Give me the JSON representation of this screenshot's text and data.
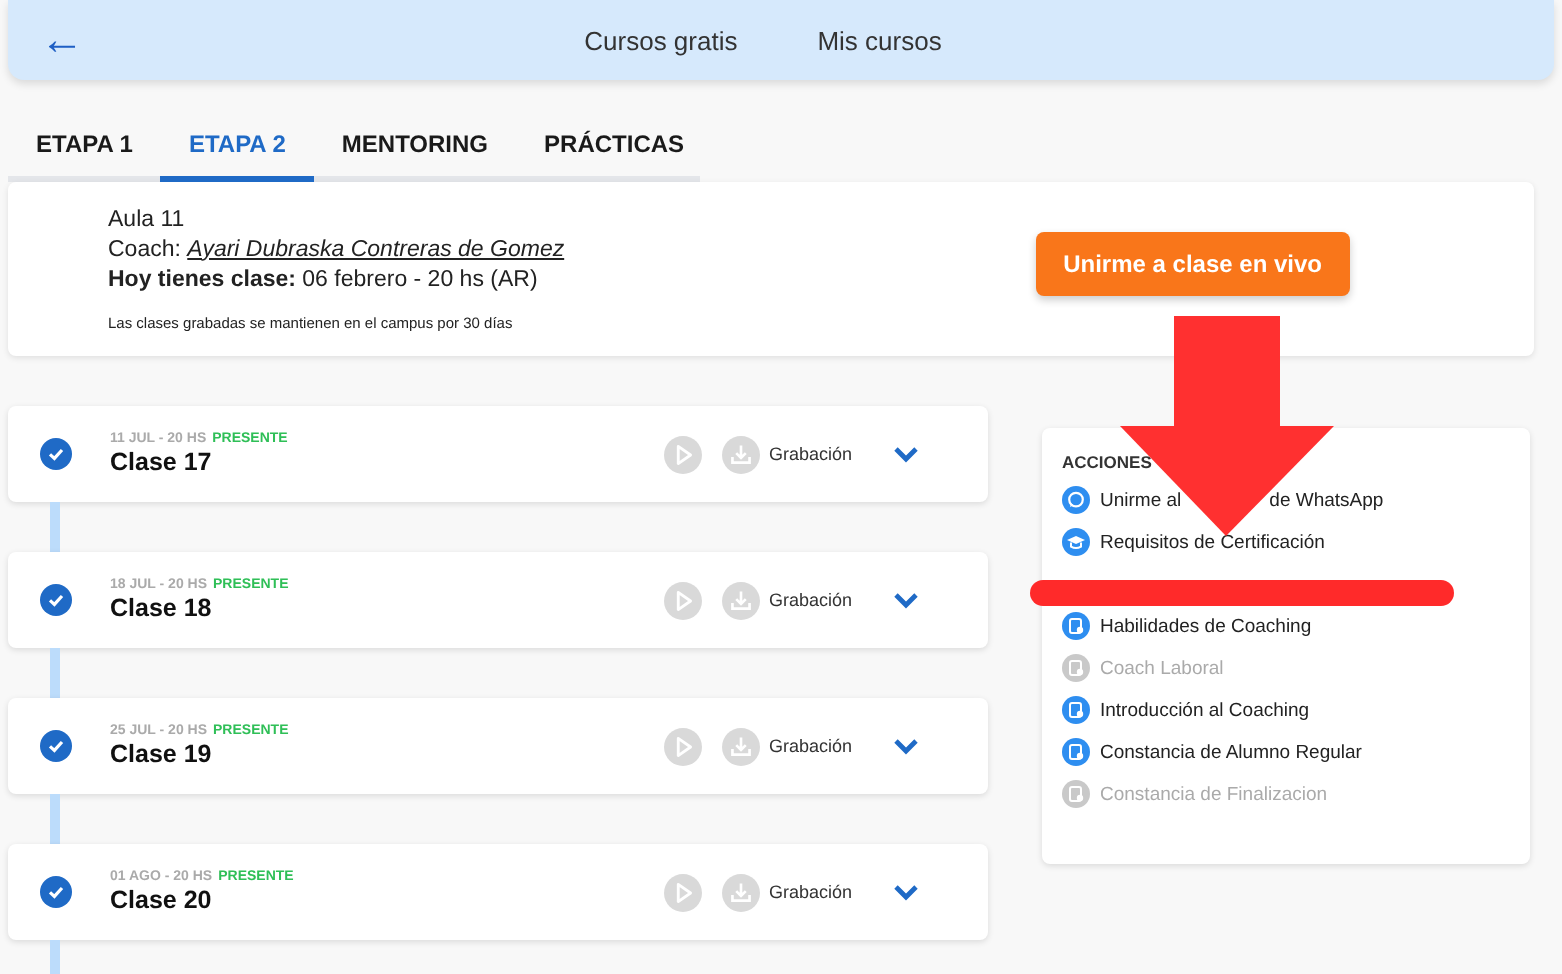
{
  "nav": {
    "back": "←",
    "links": [
      "Cursos gratis",
      "Mis cursos"
    ]
  },
  "tabs": [
    {
      "label": "ETAPA 1",
      "selected": false
    },
    {
      "label": "ETAPA 2",
      "selected": true
    },
    {
      "label": "MENTORING",
      "selected": false
    },
    {
      "label": "PRÁCTICAS",
      "selected": false
    }
  ],
  "class_info": {
    "room": "Aula 11",
    "coach_label": "Coach:",
    "coach": "Ayari Dubraska Contreras de Gomez",
    "today": "**Hoy tienes clase:** 06 febrero - 20 hs (AR)",
    "note": "Las clases grabadas se mantienen en el campus por 30 días",
    "button": "Unirme a clase en vivo"
  },
  "lessons": [
    {
      "date": "11 JUL - 20 HS",
      "status": "PRESENTE",
      "title": "Clase 17",
      "done": true,
      "recording": "Grabación"
    },
    {
      "date": "18 JUL - 20 HS",
      "status": "PRESENTE",
      "title": "Clase 18",
      "done": true,
      "recording": "Grabación"
    },
    {
      "date": "25 JUL - 20 HS",
      "status": "PRESENTE",
      "title": "Clase 19",
      "done": true,
      "recording": "Grabación"
    },
    {
      "date": "01 AGO - 20 HS",
      "status": "PRESENTE",
      "title": "Clase 20",
      "done": true,
      "recording": "Grabación"
    }
  ],
  "actions": {
    "title": "ACCIONES",
    "items": [
      {
        "kind": "whatsapp",
        "label": "Unirme al",
        "label_after": "de WhatsApp",
        "disabled": false
      },
      {
        "kind": "cap",
        "label": "Requisitos de Certificación",
        "disabled": false
      },
      {
        "kind": "hidden"
      },
      {
        "kind": "doc",
        "label": "Habilidades de Coaching",
        "disabled": false
      },
      {
        "kind": "doc",
        "label": "Coach Laboral",
        "disabled": true
      },
      {
        "kind": "doc",
        "label": "Introducción al Coaching",
        "disabled": false
      },
      {
        "kind": "doc",
        "label": "Constancia de Alumno Regular",
        "disabled": false
      },
      {
        "kind": "doc",
        "label": "Constancia de Finalizacion",
        "disabled": true
      }
    ]
  }
}
